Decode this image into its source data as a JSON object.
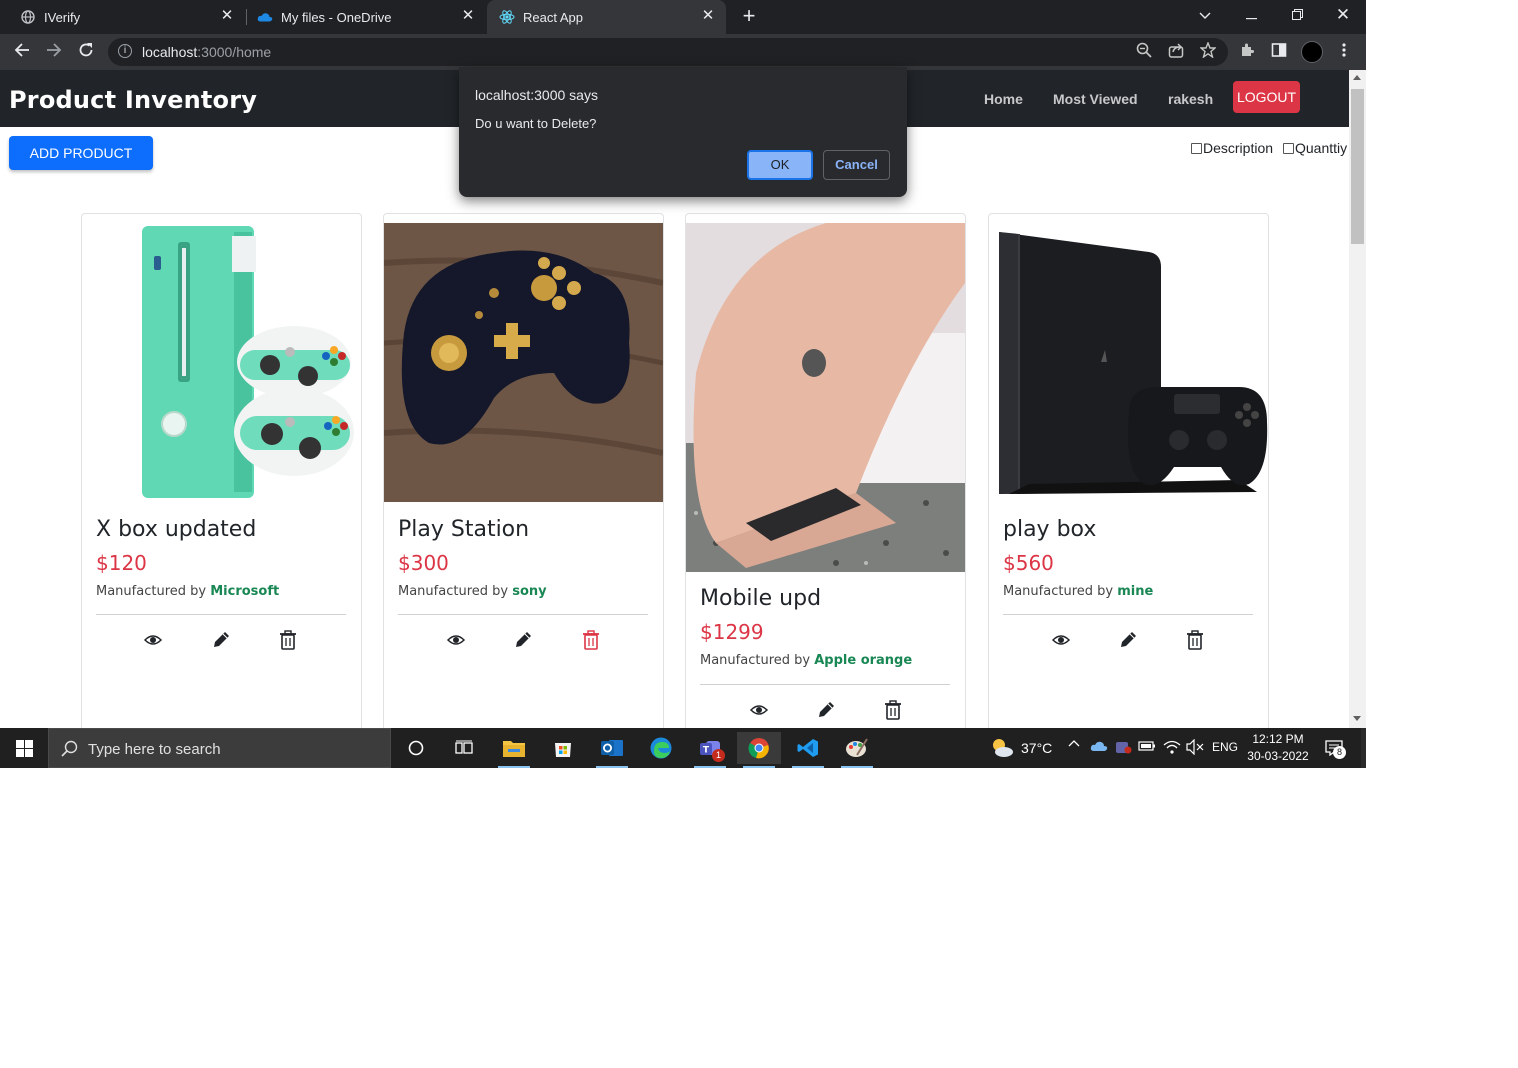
{
  "browser": {
    "tabs": [
      {
        "title": "IVerify",
        "icon": "globe-icon"
      },
      {
        "title": "My files - OneDrive",
        "icon": "onedrive-icon"
      },
      {
        "title": "React App",
        "icon": "react-icon",
        "active": true
      }
    ],
    "url_host": "localhost",
    "url_path": ":3000/home"
  },
  "app": {
    "brand": "Product Inventory",
    "nav": {
      "home": "Home",
      "most_viewed": "Most Viewed",
      "user": "rakesh",
      "logout": "LOGOUT"
    },
    "add_product": "ADD PRODUCT",
    "filters": {
      "description": "Description",
      "quantity": "Quanttiy"
    },
    "manufactured_by": "Manufactured by",
    "products": [
      {
        "name": "X box updated",
        "price": "$120",
        "maker": "Microsoft"
      },
      {
        "name": "Play Station",
        "price": "$300",
        "maker": "sony"
      },
      {
        "name": "Mobile upd",
        "price": "$1299",
        "maker": "Apple orange"
      },
      {
        "name": "play box",
        "price": "$560",
        "maker": "mine"
      }
    ],
    "colors": {
      "price": "#dc3545",
      "maker": "#198754",
      "primary": "#0d6efd",
      "danger": "#dc3545",
      "nav_bg": "#212529"
    }
  },
  "dialog": {
    "title": "localhost:3000 says",
    "message": "Do u want to Delete?",
    "ok": "OK",
    "cancel": "Cancel"
  },
  "taskbar": {
    "search_placeholder": "Type here to search",
    "weather": "37°C",
    "language": "ENG",
    "time": "12:12 PM",
    "date": "30-03-2022",
    "teams_badge": "1",
    "notifications_badge": "8"
  }
}
